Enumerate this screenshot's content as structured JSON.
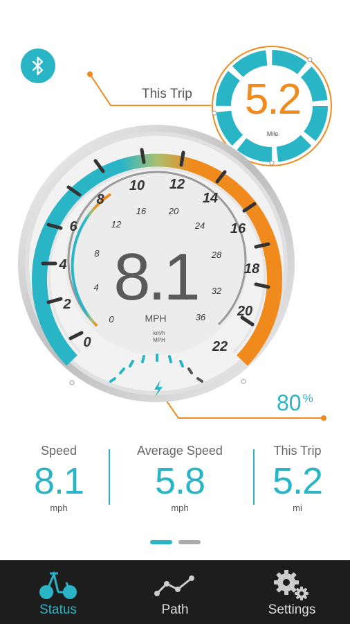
{
  "trip_widget": {
    "label": "This Trip",
    "value": "5.2",
    "unit": "Mile"
  },
  "gauge": {
    "speed": "8.1",
    "speed_unit": "MPH",
    "unit_toggle_top": "km/h",
    "unit_toggle_bottom": "MPH",
    "outer_mph_scale": [
      "0",
      "2",
      "4",
      "6",
      "8",
      "10",
      "12",
      "14",
      "16",
      "18",
      "20",
      "22"
    ],
    "inner_kmh_scale": [
      "0",
      "4",
      "8",
      "12",
      "16",
      "20",
      "24",
      "28",
      "32",
      "36"
    ],
    "battery_value": "80",
    "battery_unit": "%"
  },
  "stats": [
    {
      "label": "Speed",
      "value": "8.1",
      "unit": "mph"
    },
    {
      "label": "Average Speed",
      "value": "5.8",
      "unit": "mph"
    },
    {
      "label": "This Trip",
      "value": "5.2",
      "unit": "mi"
    }
  ],
  "pager": {
    "count": 2,
    "active": 0
  },
  "tabs": [
    {
      "label": "Status",
      "icon": "bike-icon",
      "active": true
    },
    {
      "label": "Path",
      "icon": "path-icon",
      "active": false
    },
    {
      "label": "Settings",
      "icon": "gear-icon",
      "active": false
    }
  ],
  "colors": {
    "accent": "#2ab5c6",
    "orange": "#f08a1c",
    "tabbar": "#1d1d1d"
  }
}
